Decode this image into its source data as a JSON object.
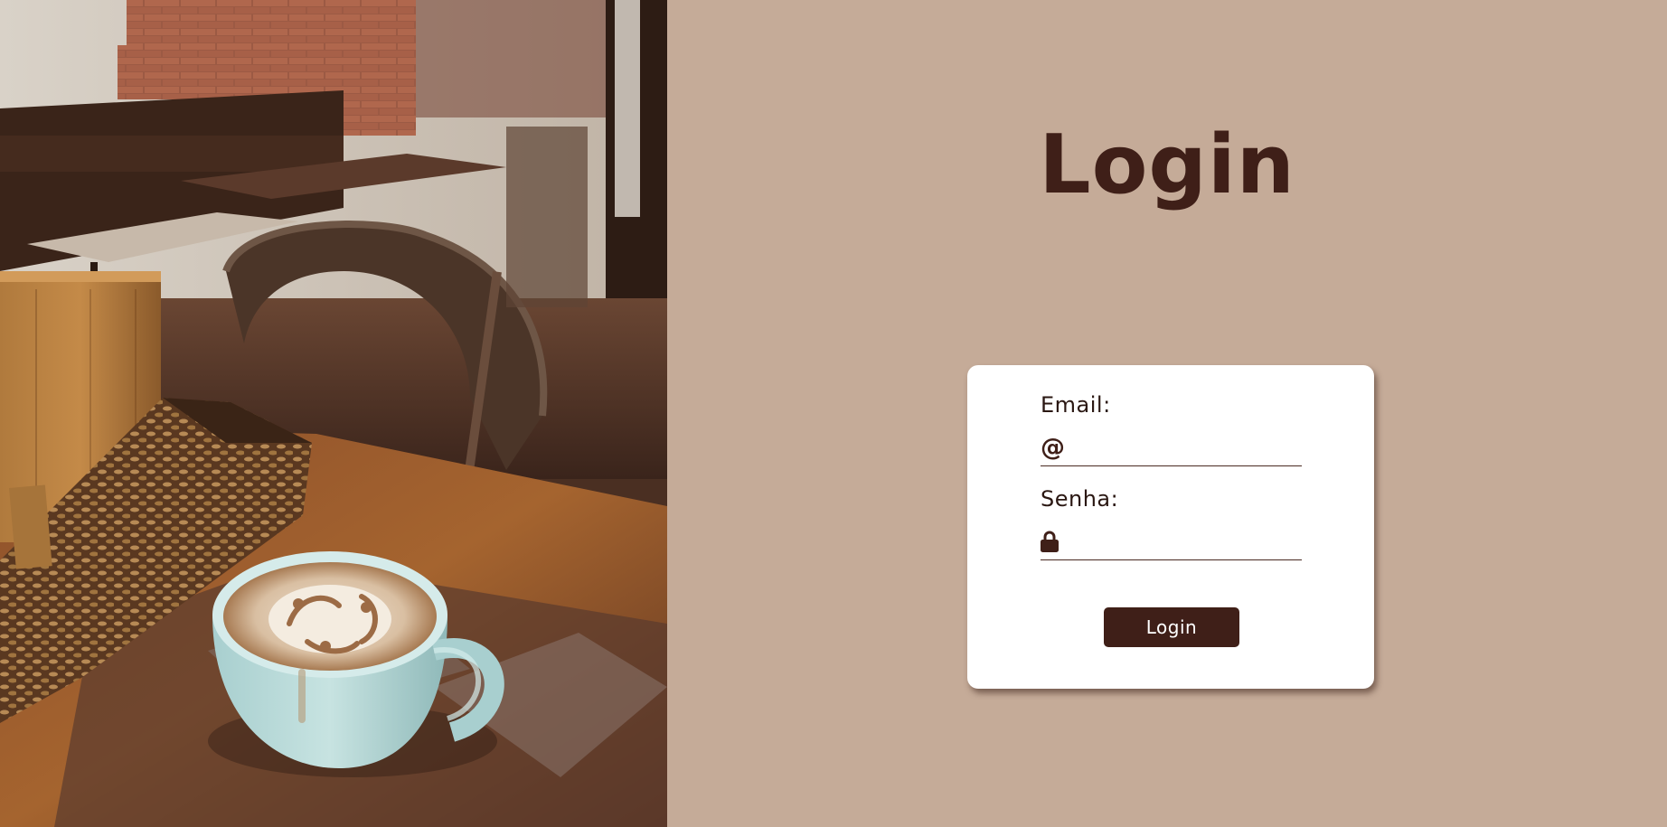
{
  "page": {
    "title": "Login",
    "background": "#c5ab98",
    "accent": "#3f1f18"
  },
  "hero_image": {
    "description_icon": "cafe-photo"
  },
  "form": {
    "email_label": "Email:",
    "email_icon": "at-sign-icon",
    "email_value": "",
    "password_label": "Senha:",
    "password_icon": "lock-icon",
    "password_value": "",
    "submit_label": "Login"
  }
}
